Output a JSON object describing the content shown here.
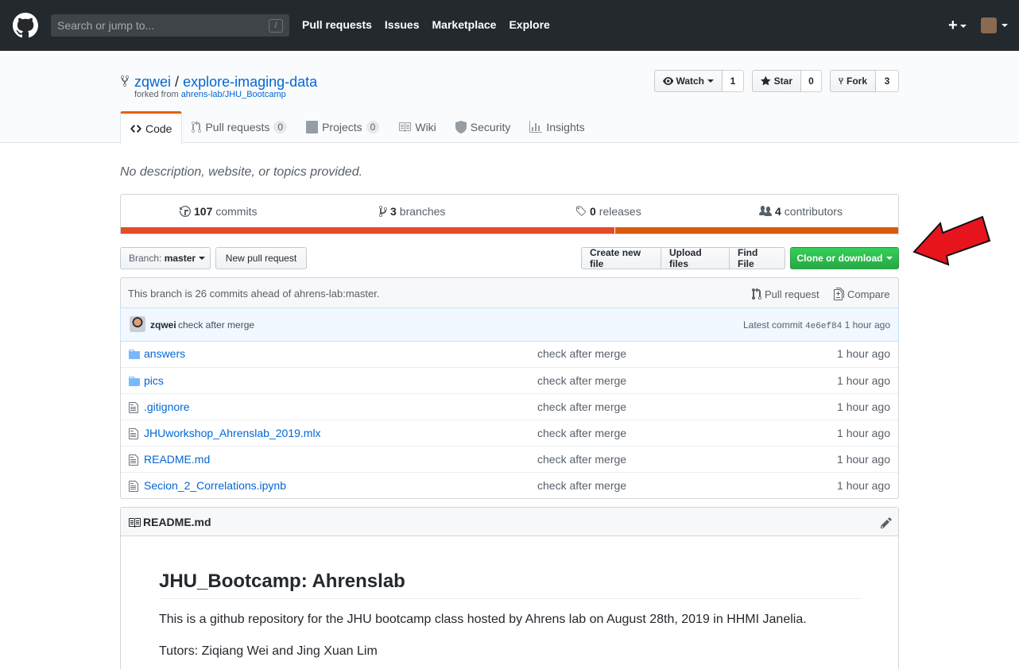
{
  "header": {
    "search_placeholder": "Search or jump to...",
    "search_shortcut": "/",
    "nav": [
      "Pull requests",
      "Issues",
      "Marketplace",
      "Explore"
    ],
    "plus_label": "+"
  },
  "repo": {
    "owner": "zqwei",
    "separator": "/",
    "name": "explore-imaging-data",
    "forked_from_prefix": "forked from ",
    "forked_from": "ahrens-lab/JHU_Bootcamp",
    "watch": {
      "label": "Watch",
      "count": "1"
    },
    "star": {
      "label": "Star",
      "count": "0"
    },
    "fork": {
      "label": "Fork",
      "count": "3"
    }
  },
  "tabs": [
    {
      "label": "Code",
      "counter": ""
    },
    {
      "label": "Pull requests",
      "counter": "0"
    },
    {
      "label": "Projects",
      "counter": "0"
    },
    {
      "label": "Wiki",
      "counter": ""
    },
    {
      "label": "Security",
      "counter": ""
    },
    {
      "label": "Insights",
      "counter": ""
    }
  ],
  "description": "No description, website, or topics provided.",
  "summary": {
    "commits": {
      "num": "107",
      "label": "commits"
    },
    "branches": {
      "num": "3",
      "label": "branches"
    },
    "releases": {
      "num": "0",
      "label": "releases"
    },
    "contributors": {
      "num": "4",
      "label": "contributors"
    },
    "language_colors": [
      "#e34c26",
      "#da5b0b"
    ],
    "language_fractions": [
      0.635,
      0.365
    ]
  },
  "file_nav": {
    "branch_prefix": "Branch:",
    "branch": "master",
    "new_pr": "New pull request",
    "create_file": "Create new file",
    "upload_files": "Upload files",
    "find_file": "Find File",
    "clone": "Clone or download"
  },
  "branch_info": {
    "text": "This branch is 26 commits ahead of ahrens-lab:master.",
    "pull_request": "Pull request",
    "compare": "Compare"
  },
  "latest_commit": {
    "author": "zqwei",
    "message": "check after merge",
    "label": "Latest commit",
    "sha": "4e6ef84",
    "age": "1 hour ago"
  },
  "files": [
    {
      "type": "dir",
      "name": "answers",
      "message": "check after merge",
      "age": "1 hour ago"
    },
    {
      "type": "dir",
      "name": "pics",
      "message": "check after merge",
      "age": "1 hour ago"
    },
    {
      "type": "file",
      "name": ".gitignore",
      "message": "check after merge",
      "age": "1 hour ago"
    },
    {
      "type": "file",
      "name": "JHUworkshop_Ahrenslab_2019.mlx",
      "message": "check after merge",
      "age": "1 hour ago"
    },
    {
      "type": "file",
      "name": "README.md",
      "message": "check after merge",
      "age": "1 hour ago"
    },
    {
      "type": "file",
      "name": "Secion_2_Correlations.ipynb",
      "message": "check after merge",
      "age": "1 hour ago"
    }
  ],
  "readme": {
    "filename": "README.md",
    "heading": "JHU_Bootcamp: Ahrenslab",
    "para1": "This is a github repository for the JHU bootcamp class hosted by Ahrens lab on August 28th, 2019 in HHMI Janelia.",
    "para2": "Tutors: Ziqiang Wei and Jing Xuan Lim"
  },
  "annotation": {
    "arrow_color": "#e8141d",
    "icon": "red-arrow-pointing-left"
  }
}
